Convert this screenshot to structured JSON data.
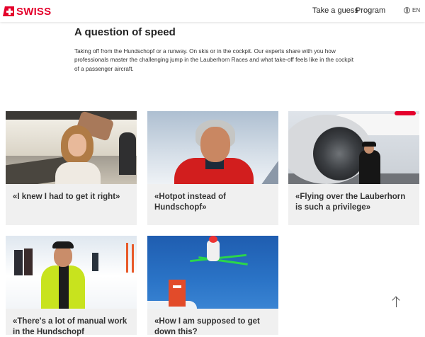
{
  "header": {
    "logo_text": "SWISS",
    "nav": [
      "Take a guess",
      "Program"
    ],
    "language": "EN",
    "brand_color": "#e4002b"
  },
  "intro": {
    "title": "A question of speed",
    "text": "Taking off from the Hundschopf or a runway. On skis or in the cockpit. Our experts share with you how professionals master the challenging jump in the Lauberhorn Races and what take-off feels like in the cockpit of a passenger aircraft."
  },
  "cards": [
    {
      "caption": "«I knew I had to get it right»"
    },
    {
      "caption": "«Hotpot instead of Hundschopf»"
    },
    {
      "caption": "«Flying over the Lauberhorn is such a privilege»"
    },
    {
      "caption": "«There's a lot of manual work in the Hundschopf"
    },
    {
      "caption": "«How I am supposed to get down this?"
    }
  ],
  "icons": {
    "language": "globe-icon",
    "back_to_top": "arrow-up-icon"
  }
}
